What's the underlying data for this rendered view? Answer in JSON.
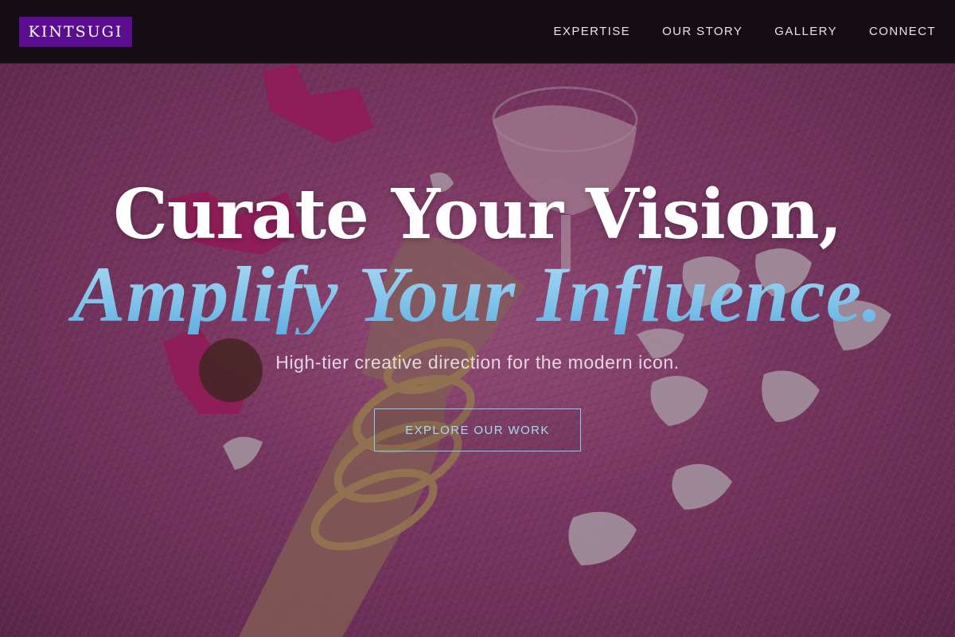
{
  "brand": {
    "logo_text": "KINTSUGI",
    "logo_bg": "#5a0d8f"
  },
  "nav": {
    "items": [
      {
        "label": "EXPERTISE"
      },
      {
        "label": "OUR STORY"
      },
      {
        "label": "GALLERY"
      },
      {
        "label": "CONNECT"
      }
    ]
  },
  "hero": {
    "headline_line1": "Curate Your Vision,",
    "headline_line2": "Amplify Your Influence.",
    "subtitle": "High-tier creative direction for the modern icon.",
    "cta_label": "EXPLORE OUR WORK",
    "background_image": "pink fur rug with hand in gold chain bracelets, rose petals, candy and a pink drink glass",
    "accent_color": "#8ac8ee"
  }
}
